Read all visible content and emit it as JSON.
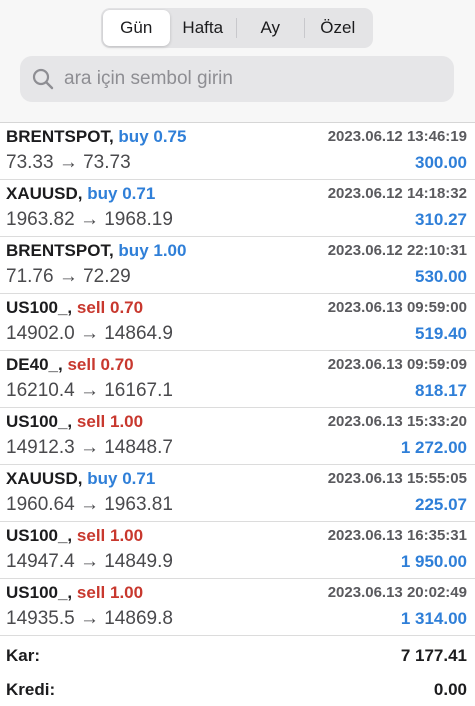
{
  "tabs": [
    {
      "label": "Gün",
      "active": true
    },
    {
      "label": "Hafta",
      "active": false
    },
    {
      "label": "Ay",
      "active": false
    },
    {
      "label": "Özel",
      "active": false
    }
  ],
  "search": {
    "placeholder": "ara için sembol girin",
    "icon": "search-icon"
  },
  "colors": {
    "buy": "#2f7fd8",
    "sell": "#c8382e",
    "profit": "#2f7fd8"
  },
  "deals": [
    {
      "symbol": "BRENTSPOT,",
      "side": "buy 0.75",
      "type": "buy",
      "time": "2023.06.12 13:46:19",
      "prices": "73.33 → 73.73",
      "profit": "300.00"
    },
    {
      "symbol": "XAUUSD,",
      "side": "buy 0.71",
      "type": "buy",
      "time": "2023.06.12 14:18:32",
      "prices": "1963.82 → 1968.19",
      "profit": "310.27"
    },
    {
      "symbol": "BRENTSPOT,",
      "side": "buy 1.00",
      "type": "buy",
      "time": "2023.06.12 22:10:31",
      "prices": "71.76 → 72.29",
      "profit": "530.00"
    },
    {
      "symbol": "US100_,",
      "side": "sell 0.70",
      "type": "sell",
      "time": "2023.06.13 09:59:00",
      "prices": "14902.0 → 14864.9",
      "profit": "519.40"
    },
    {
      "symbol": "DE40_,",
      "side": "sell 0.70",
      "type": "sell",
      "time": "2023.06.13 09:59:09",
      "prices": "16210.4 → 16167.1",
      "profit": "818.17"
    },
    {
      "symbol": "US100_,",
      "side": "sell 1.00",
      "type": "sell",
      "time": "2023.06.13 15:33:20",
      "prices": "14912.3 → 14848.7",
      "profit": "1 272.00"
    },
    {
      "symbol": "XAUUSD,",
      "side": "buy 0.71",
      "type": "buy",
      "time": "2023.06.13 15:55:05",
      "prices": "1960.64 → 1963.81",
      "profit": "225.07"
    },
    {
      "symbol": "US100_,",
      "side": "sell 1.00",
      "type": "sell",
      "time": "2023.06.13 16:35:31",
      "prices": "14947.4 → 14849.9",
      "profit": "1 950.00"
    },
    {
      "symbol": "US100_,",
      "side": "sell 1.00",
      "type": "sell",
      "time": "2023.06.13 20:02:49",
      "prices": "14935.5 → 14869.8",
      "profit": "1 314.00"
    }
  ],
  "summary": [
    {
      "label": "Kar:",
      "value": "7 177.41"
    },
    {
      "label": "Kredi:",
      "value": "0.00"
    }
  ]
}
